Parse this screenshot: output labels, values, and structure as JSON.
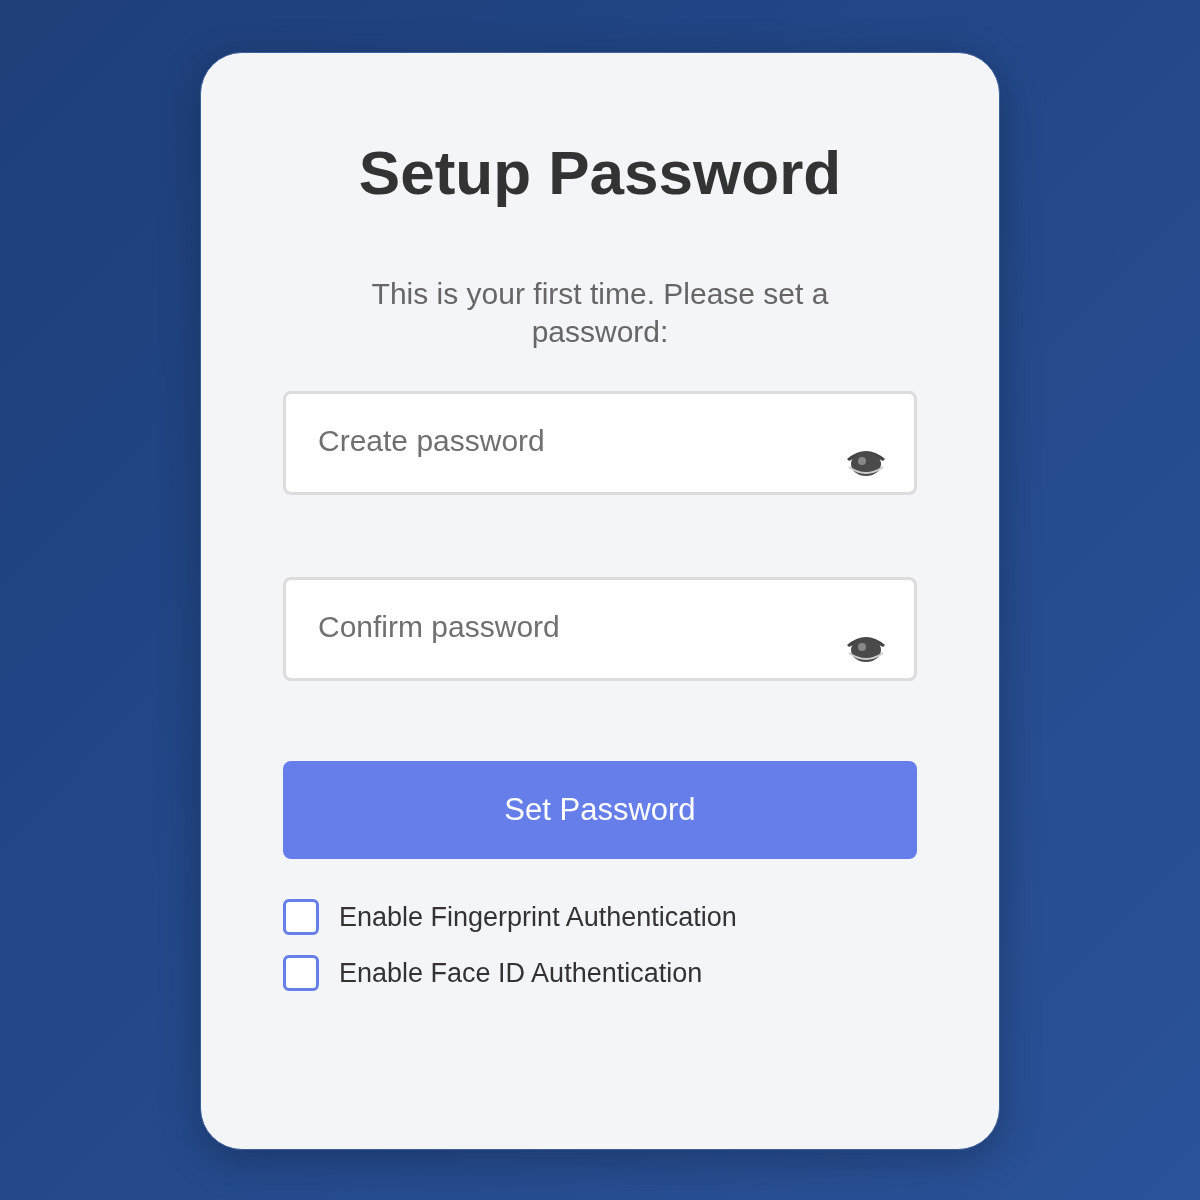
{
  "title": "Setup Password",
  "subtitle": "This is your first time. Please set a password:",
  "fields": [
    {
      "placeholder": "Create password"
    },
    {
      "placeholder": "Confirm password"
    }
  ],
  "submit_button": "Set Password",
  "options": [
    {
      "label": "Enable Fingerprint Authentication",
      "checked": false
    },
    {
      "label": "Enable Face ID Authentication",
      "checked": false
    }
  ]
}
